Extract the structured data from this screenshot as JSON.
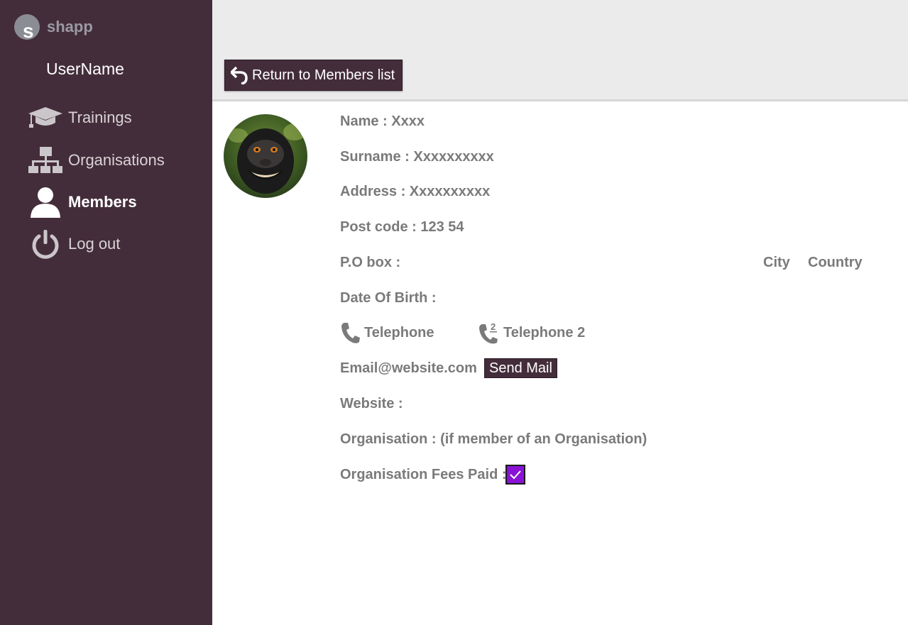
{
  "brand": {
    "name": "shapp",
    "logo_letter": "s"
  },
  "user": {
    "name": "UserName"
  },
  "nav": {
    "trainings": "Trainings",
    "organisations": "Organisations",
    "members": "Members",
    "logout": "Log out"
  },
  "actions": {
    "return_label": "Return to Members list",
    "send_mail_label": "Send Mail"
  },
  "member": {
    "name": "Name : Xxxx",
    "surname": "Surname : Xxxxxxxxxx",
    "address": "Address : Xxxxxxxxxx",
    "postcode": "Post code : 123 54",
    "pobox": "P.O box :",
    "city": "City",
    "country": "Country",
    "dob": "Date Of Birth :",
    "telephone": "Telephone",
    "telephone2": "Telephone 2",
    "telephone2_badge": "2",
    "email": "Email@website.com",
    "website": "Website :",
    "organisation": "Organisation : (if member of an Organisation)",
    "fees_paid_label": "Organisation Fees Paid :",
    "fees_paid": true
  },
  "colors": {
    "sidebar": "#442d3a",
    "checkbox": "#8a12d6",
    "text": "#7a7a7a",
    "topbar": "#ebebeb"
  },
  "icons": [
    "graduation-cap-icon",
    "org-chart-icon",
    "person-icon",
    "power-icon",
    "return-arrow-icon",
    "phone-icon",
    "checkmark-icon"
  ]
}
